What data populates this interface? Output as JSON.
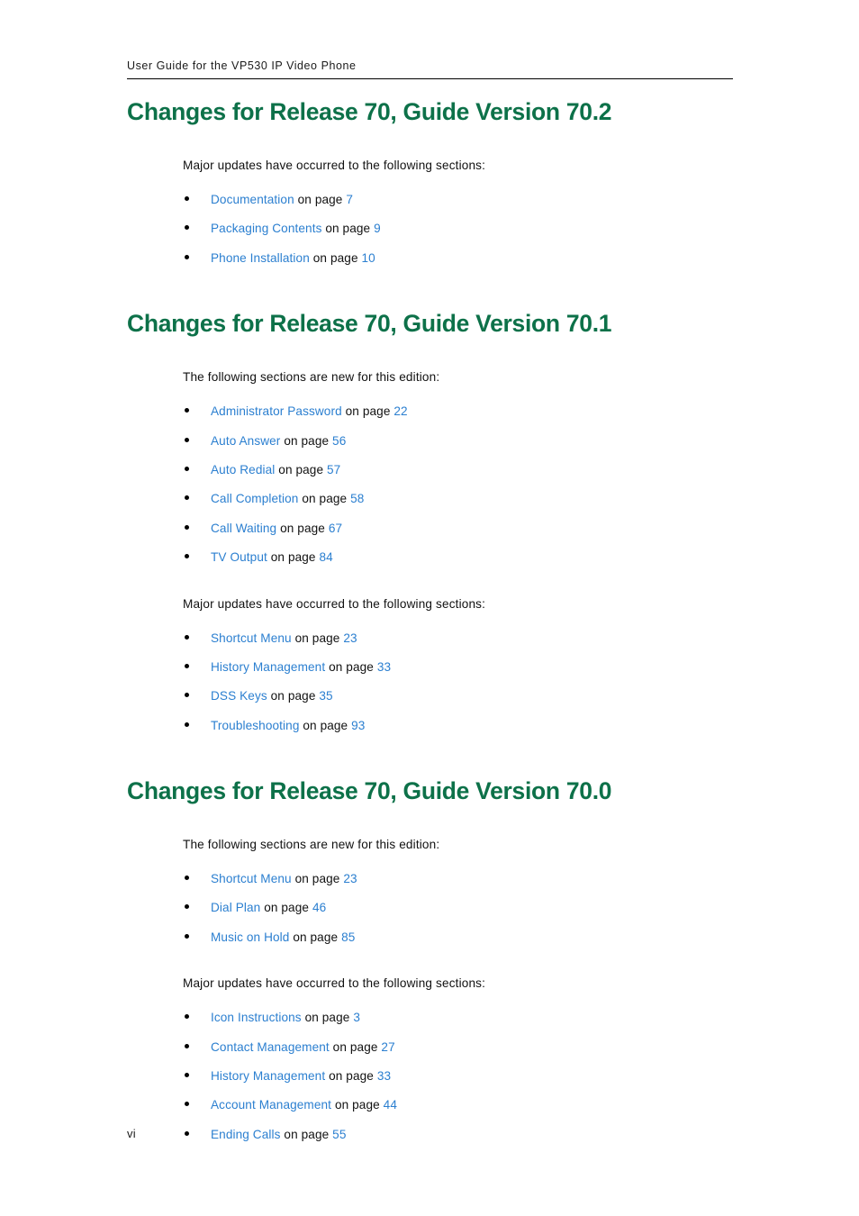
{
  "colors": {
    "heading_green": "#0d7149",
    "link_blue": "#2b7fd0",
    "body_black": "#111111",
    "rule_black": "#000000",
    "page_background": "#ffffff"
  },
  "header": {
    "running_title": "User Guide for the VP530 IP Video Phone"
  },
  "footer": {
    "page_label": "vi"
  },
  "common": {
    "on_page_text": "on page",
    "lead_major_updates": "Major updates have occurred to the following sections:",
    "lead_new_sections": "The following sections are new for this edition:"
  },
  "sections": [
    {
      "title": "Changes for Release 70, Guide Version 70.2",
      "groups": [
        {
          "lead": "Major updates have occurred to the following sections:",
          "items": [
            {
              "label": "Documentation",
              "connector": "on page",
              "page": "7"
            },
            {
              "label": "Packaging Contents",
              "connector": "on page",
              "page": "9"
            },
            {
              "label": "Phone Installation",
              "connector": "on page",
              "page": "10"
            }
          ]
        }
      ]
    },
    {
      "title": "Changes for Release 70, Guide Version 70.1",
      "groups": [
        {
          "lead": "The following sections are new for this edition:",
          "items": [
            {
              "label": "Administrator Password",
              "connector": "on page",
              "page": "22"
            },
            {
              "label": "Auto Answer",
              "connector": "on page",
              "page": "56"
            },
            {
              "label": "Auto Redial",
              "connector": "on page",
              "page": "57"
            },
            {
              "label": "Call Completion",
              "connector": "on page",
              "page": "58"
            },
            {
              "label": "Call Waiting",
              "connector": "on page",
              "page": "67"
            },
            {
              "label": "TV Output",
              "connector": "on page",
              "page": "84"
            }
          ]
        },
        {
          "lead": "Major updates have occurred to the following sections:",
          "items": [
            {
              "label": "Shortcut Menu",
              "connector": "on page",
              "page": "23"
            },
            {
              "label": "History Management",
              "connector": "on page",
              "page": "33"
            },
            {
              "label": "DSS Keys",
              "connector": "on page",
              "page": "35"
            },
            {
              "label": "Troubleshooting",
              "connector": "on page",
              "page": "93"
            }
          ]
        }
      ]
    },
    {
      "title": "Changes for Release 70, Guide Version 70.0",
      "groups": [
        {
          "lead": "The following sections are new for this edition:",
          "items": [
            {
              "label": "Shortcut Menu",
              "connector": "on page",
              "page": "23"
            },
            {
              "label": "Dial Plan",
              "connector": "on page",
              "page": "46"
            },
            {
              "label": "Music on Hold",
              "connector": "on page",
              "page": "85"
            }
          ]
        },
        {
          "lead": "Major updates have occurred to the following sections:",
          "items": [
            {
              "label": "Icon Instructions",
              "connector": "on page",
              "page": "3"
            },
            {
              "label": "Contact Management",
              "connector": "on page",
              "page": "27"
            },
            {
              "label": "History Management",
              "connector": "on page",
              "page": "33"
            },
            {
              "label": "Account Management",
              "connector": "on page",
              "page": "44"
            },
            {
              "label": "Ending Calls",
              "connector": "on page",
              "page": "55"
            }
          ]
        }
      ]
    }
  ]
}
